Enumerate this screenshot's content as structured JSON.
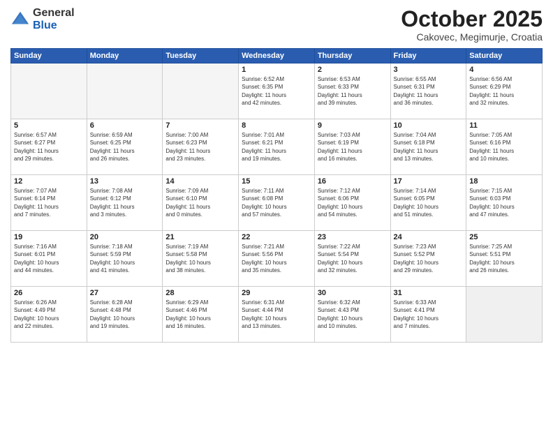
{
  "header": {
    "logo_general": "General",
    "logo_blue": "Blue",
    "title": "October 2025",
    "subtitle": "Cakovec, Megimurje, Croatia"
  },
  "weekdays": [
    "Sunday",
    "Monday",
    "Tuesday",
    "Wednesday",
    "Thursday",
    "Friday",
    "Saturday"
  ],
  "weeks": [
    [
      {
        "day": "",
        "info": ""
      },
      {
        "day": "",
        "info": ""
      },
      {
        "day": "",
        "info": ""
      },
      {
        "day": "1",
        "info": "Sunrise: 6:52 AM\nSunset: 6:35 PM\nDaylight: 11 hours\nand 42 minutes."
      },
      {
        "day": "2",
        "info": "Sunrise: 6:53 AM\nSunset: 6:33 PM\nDaylight: 11 hours\nand 39 minutes."
      },
      {
        "day": "3",
        "info": "Sunrise: 6:55 AM\nSunset: 6:31 PM\nDaylight: 11 hours\nand 36 minutes."
      },
      {
        "day": "4",
        "info": "Sunrise: 6:56 AM\nSunset: 6:29 PM\nDaylight: 11 hours\nand 32 minutes."
      }
    ],
    [
      {
        "day": "5",
        "info": "Sunrise: 6:57 AM\nSunset: 6:27 PM\nDaylight: 11 hours\nand 29 minutes."
      },
      {
        "day": "6",
        "info": "Sunrise: 6:59 AM\nSunset: 6:25 PM\nDaylight: 11 hours\nand 26 minutes."
      },
      {
        "day": "7",
        "info": "Sunrise: 7:00 AM\nSunset: 6:23 PM\nDaylight: 11 hours\nand 23 minutes."
      },
      {
        "day": "8",
        "info": "Sunrise: 7:01 AM\nSunset: 6:21 PM\nDaylight: 11 hours\nand 19 minutes."
      },
      {
        "day": "9",
        "info": "Sunrise: 7:03 AM\nSunset: 6:19 PM\nDaylight: 11 hours\nand 16 minutes."
      },
      {
        "day": "10",
        "info": "Sunrise: 7:04 AM\nSunset: 6:18 PM\nDaylight: 11 hours\nand 13 minutes."
      },
      {
        "day": "11",
        "info": "Sunrise: 7:05 AM\nSunset: 6:16 PM\nDaylight: 11 hours\nand 10 minutes."
      }
    ],
    [
      {
        "day": "12",
        "info": "Sunrise: 7:07 AM\nSunset: 6:14 PM\nDaylight: 11 hours\nand 7 minutes."
      },
      {
        "day": "13",
        "info": "Sunrise: 7:08 AM\nSunset: 6:12 PM\nDaylight: 11 hours\nand 3 minutes."
      },
      {
        "day": "14",
        "info": "Sunrise: 7:09 AM\nSunset: 6:10 PM\nDaylight: 11 hours\nand 0 minutes."
      },
      {
        "day": "15",
        "info": "Sunrise: 7:11 AM\nSunset: 6:08 PM\nDaylight: 10 hours\nand 57 minutes."
      },
      {
        "day": "16",
        "info": "Sunrise: 7:12 AM\nSunset: 6:06 PM\nDaylight: 10 hours\nand 54 minutes."
      },
      {
        "day": "17",
        "info": "Sunrise: 7:14 AM\nSunset: 6:05 PM\nDaylight: 10 hours\nand 51 minutes."
      },
      {
        "day": "18",
        "info": "Sunrise: 7:15 AM\nSunset: 6:03 PM\nDaylight: 10 hours\nand 47 minutes."
      }
    ],
    [
      {
        "day": "19",
        "info": "Sunrise: 7:16 AM\nSunset: 6:01 PM\nDaylight: 10 hours\nand 44 minutes."
      },
      {
        "day": "20",
        "info": "Sunrise: 7:18 AM\nSunset: 5:59 PM\nDaylight: 10 hours\nand 41 minutes."
      },
      {
        "day": "21",
        "info": "Sunrise: 7:19 AM\nSunset: 5:58 PM\nDaylight: 10 hours\nand 38 minutes."
      },
      {
        "day": "22",
        "info": "Sunrise: 7:21 AM\nSunset: 5:56 PM\nDaylight: 10 hours\nand 35 minutes."
      },
      {
        "day": "23",
        "info": "Sunrise: 7:22 AM\nSunset: 5:54 PM\nDaylight: 10 hours\nand 32 minutes."
      },
      {
        "day": "24",
        "info": "Sunrise: 7:23 AM\nSunset: 5:52 PM\nDaylight: 10 hours\nand 29 minutes."
      },
      {
        "day": "25",
        "info": "Sunrise: 7:25 AM\nSunset: 5:51 PM\nDaylight: 10 hours\nand 26 minutes."
      }
    ],
    [
      {
        "day": "26",
        "info": "Sunrise: 6:26 AM\nSunset: 4:49 PM\nDaylight: 10 hours\nand 22 minutes."
      },
      {
        "day": "27",
        "info": "Sunrise: 6:28 AM\nSunset: 4:48 PM\nDaylight: 10 hours\nand 19 minutes."
      },
      {
        "day": "28",
        "info": "Sunrise: 6:29 AM\nSunset: 4:46 PM\nDaylight: 10 hours\nand 16 minutes."
      },
      {
        "day": "29",
        "info": "Sunrise: 6:31 AM\nSunset: 4:44 PM\nDaylight: 10 hours\nand 13 minutes."
      },
      {
        "day": "30",
        "info": "Sunrise: 6:32 AM\nSunset: 4:43 PM\nDaylight: 10 hours\nand 10 minutes."
      },
      {
        "day": "31",
        "info": "Sunrise: 6:33 AM\nSunset: 4:41 PM\nDaylight: 10 hours\nand 7 minutes."
      },
      {
        "day": "",
        "info": ""
      }
    ]
  ]
}
